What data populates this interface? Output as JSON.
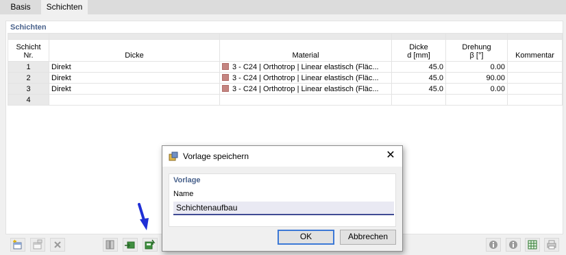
{
  "tabs": [
    {
      "label": "Basis"
    },
    {
      "label": "Schichten"
    }
  ],
  "section_title": "Schichten",
  "table": {
    "headers": {
      "nr": [
        "Schicht",
        "Nr."
      ],
      "dicke": "Dicke",
      "material": "Material",
      "thickness": [
        "Dicke",
        "d [mm]"
      ],
      "rotation": [
        "Drehung",
        "β [°]"
      ],
      "comment": "Kommentar"
    },
    "rows": [
      {
        "nr": "1",
        "dicke": "Direkt",
        "material": "3 - C24 | Orthotrop | Linear elastisch (Fläc...",
        "thickness": "45.0",
        "rotation": "0.00",
        "comment": ""
      },
      {
        "nr": "2",
        "dicke": "Direkt",
        "material": "3 - C24 | Orthotrop | Linear elastisch (Fläc...",
        "thickness": "45.0",
        "rotation": "90.00",
        "comment": ""
      },
      {
        "nr": "3",
        "dicke": "Direkt",
        "material": "3 - C24 | Orthotrop | Linear elastisch (Fläc...",
        "thickness": "45.0",
        "rotation": "0.00",
        "comment": ""
      },
      {
        "nr": "4",
        "dicke": "",
        "material": "",
        "thickness": "",
        "rotation": "",
        "comment": ""
      }
    ],
    "material_color": "#c48581"
  },
  "dialog": {
    "title": "Vorlage speichern",
    "group_title": "Vorlage",
    "name_label": "Name",
    "name_value": "Schichtenaufbau",
    "ok_label": "OK",
    "cancel_label": "Abbrechen"
  },
  "colors": {
    "accent": "#49628c",
    "arrow": "#1f2fd6"
  }
}
